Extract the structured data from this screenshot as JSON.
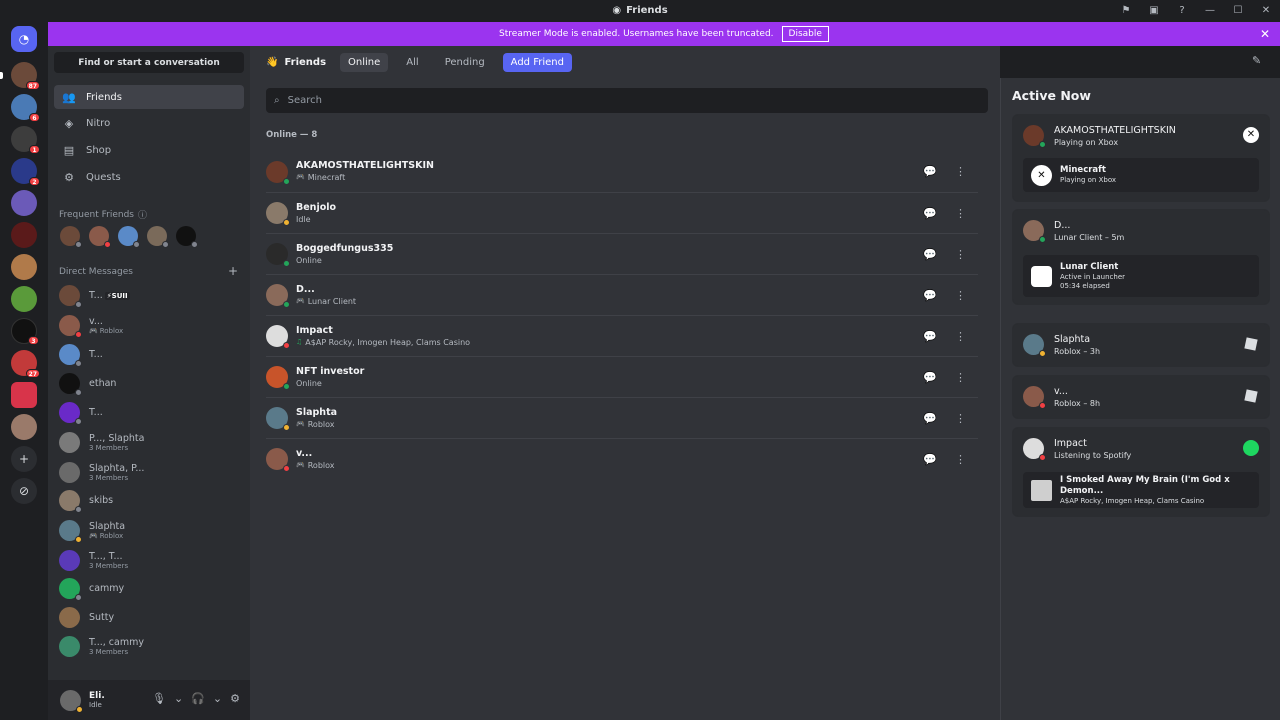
{
  "window": {
    "title": "Friends"
  },
  "banner": {
    "text": "Streamer Mode is enabled. Usernames have been truncated.",
    "button": "Disable"
  },
  "servers": [
    {
      "badge": ""
    },
    {
      "badge": "87"
    },
    {
      "badge": "6"
    },
    {
      "badge": "1"
    },
    {
      "badge": "2"
    },
    {
      "badge": ""
    },
    {
      "badge": ""
    },
    {
      "badge": ""
    },
    {
      "badge": ""
    },
    {
      "badge": "3"
    },
    {
      "badge": "27"
    },
    {
      "badge": ""
    },
    {
      "badge": ""
    }
  ],
  "sidebar": {
    "find": "Find or start a conversation",
    "nav": [
      {
        "label": "Friends",
        "icon": "people-icon"
      },
      {
        "label": "Nitro",
        "icon": "nitro-icon"
      },
      {
        "label": "Shop",
        "icon": "shop-icon"
      },
      {
        "label": "Quests",
        "icon": "quests-icon"
      }
    ],
    "frequent_header": "Frequent Friends",
    "dm_header": "Direct Messages",
    "dms": [
      {
        "name": "T...",
        "sub": "",
        "tag": "⚡SUII"
      },
      {
        "name": "v...",
        "sub": "Roblox",
        "tag": ""
      },
      {
        "name": "T...",
        "sub": "",
        "tag": ""
      },
      {
        "name": "ethan",
        "sub": "",
        "tag": ""
      },
      {
        "name": "T...",
        "sub": "",
        "tag": ""
      },
      {
        "name": "P..., Slaphta",
        "sub": "3 Members",
        "tag": ""
      },
      {
        "name": "Slaphta, P...",
        "sub": "3 Members",
        "tag": ""
      },
      {
        "name": "skibs",
        "sub": "",
        "tag": ""
      },
      {
        "name": "Slaphta",
        "sub": "Roblox",
        "tag": ""
      },
      {
        "name": "T..., T...",
        "sub": "3 Members",
        "tag": ""
      },
      {
        "name": "cammy",
        "sub": "",
        "tag": ""
      },
      {
        "name": "Sutty",
        "sub": "",
        "tag": ""
      },
      {
        "name": "T..., cammy",
        "sub": "3 Members",
        "tag": ""
      }
    ],
    "user": {
      "name": "Eli.",
      "status": "Idle"
    }
  },
  "toolbar": {
    "friends": "Friends",
    "tabs": [
      "Online",
      "All",
      "Pending"
    ],
    "add": "Add Friend"
  },
  "search": {
    "placeholder": "Search"
  },
  "online_header": "Online — 8",
  "friends": [
    {
      "name": "AKAMOSTHATELIGHTSKIN",
      "status": "Minecraft"
    },
    {
      "name": "Benjolo",
      "status": "Idle"
    },
    {
      "name": "Boggedfungus335",
      "status": "Online"
    },
    {
      "name": "D...",
      "status": "Lunar Client"
    },
    {
      "name": "Impact",
      "status": "A$AP Rocky, Imogen Heap, Clams Casino"
    },
    {
      "name": "NFT investor",
      "status": "Online"
    },
    {
      "name": "Slaphta",
      "status": "Roblox"
    },
    {
      "name": "v...",
      "status": "Roblox"
    }
  ],
  "active_now": {
    "title": "Active Now",
    "cards": [
      {
        "name": "AKAMOSTHATELIGHTSKIN",
        "sub": "Playing on Xbox",
        "inner_title": "Minecraft",
        "inner_sub": "Playing on Xbox",
        "inner_sub2": ""
      },
      {
        "name": "D...",
        "sub": "Lunar Client – 5m",
        "inner_title": "Lunar Client",
        "inner_sub": "Active in Launcher",
        "inner_sub2": "05:34 elapsed"
      },
      {
        "name": "Slaphta",
        "sub": "Roblox – 3h"
      },
      {
        "name": "v...",
        "sub": "Roblox – 8h"
      },
      {
        "name": "Impact",
        "sub": "Listening to Spotify",
        "inner_title": "I Smoked Away My Brain (I'm God x Demon...",
        "inner_sub": "A$AP Rocky, Imogen Heap, Clams Casino",
        "inner_sub2": ""
      }
    ]
  },
  "colors": {
    "accent": "#5865f2",
    "banner": "#9b34ef",
    "online": "#23a55a",
    "idle": "#f0b232",
    "dnd": "#f23f43"
  }
}
